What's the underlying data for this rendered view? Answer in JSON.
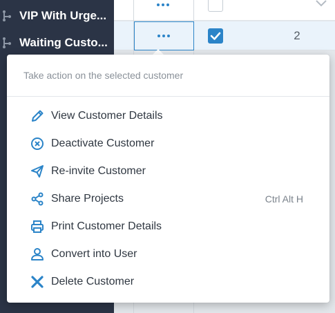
{
  "sidebar": {
    "items": [
      {
        "label": "VIP With Urge..."
      },
      {
        "label": "Waiting Custo..."
      }
    ]
  },
  "grid": {
    "row2_value": "2"
  },
  "menu": {
    "header": "Take action on the selected customer",
    "items": [
      {
        "label": "View Customer Details",
        "icon": "pencil-icon"
      },
      {
        "label": "Deactivate Customer",
        "icon": "circle-x-icon"
      },
      {
        "label": "Re-invite Customer",
        "icon": "paper-plane-icon"
      },
      {
        "label": "Share Projects",
        "icon": "share-icon",
        "shortcut": "Ctrl Alt H"
      },
      {
        "label": "Print Customer Details",
        "icon": "printer-icon"
      },
      {
        "label": "Convert into User",
        "icon": "user-icon"
      },
      {
        "label": "Delete Customer",
        "icon": "x-icon"
      }
    ]
  },
  "colors": {
    "accent": "#2b84c8",
    "sidebar_bg": "#2b3446",
    "text": "#2f3741"
  }
}
